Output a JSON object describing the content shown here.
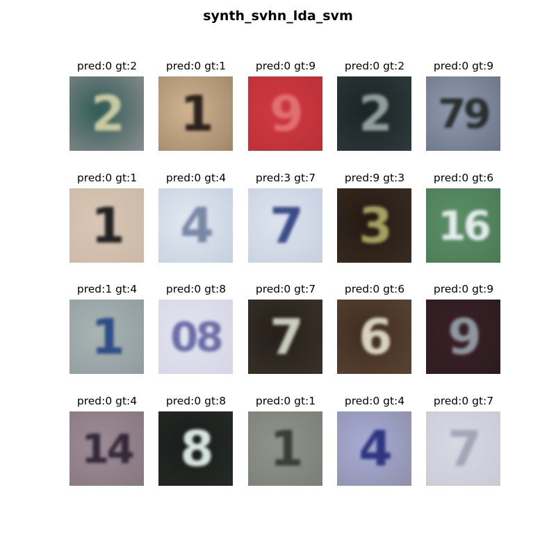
{
  "title": "synth_svhn_lda_svm",
  "samples": [
    {
      "label": "pred:0 gt:2",
      "digit_text": "2",
      "bg": "#2f5c55",
      "bg2": "#8b8c8e",
      "fg": "#c9c9a0"
    },
    {
      "label": "pred:0 gt:1",
      "digit_text": "1",
      "bg": "#cfb48f",
      "bg2": "#a0876a",
      "fg": "#2b221c"
    },
    {
      "label": "pred:0 gt:9",
      "digit_text": "9",
      "bg": "#d2383f",
      "bg2": "#b83038",
      "fg": "#e07070"
    },
    {
      "label": "pred:0 gt:2",
      "digit_text": "2",
      "bg": "#1b2325",
      "bg2": "#2e3a3b",
      "fg": "#8f9e9a"
    },
    {
      "label": "pred:0 gt:9",
      "digit_text": "79",
      "bg": "#8f9bb0",
      "bg2": "#6a7388",
      "fg": "#2a2f2c"
    },
    {
      "label": "pred:0 gt:1",
      "digit_text": "1",
      "bg": "#d9c6b4",
      "bg2": "#cbb8a6",
      "fg": "#222"
    },
    {
      "label": "pred:0 gt:4",
      "digit_text": "4",
      "bg": "#e3e8f0",
      "bg2": "#c4cfdf",
      "fg": "#7a88a5"
    },
    {
      "label": "pred:3 gt:7",
      "digit_text": "7",
      "bg": "#dde3ee",
      "bg2": "#c7cfe0",
      "fg": "#3b4c88"
    },
    {
      "label": "pred:9 gt:3",
      "digit_text": "3",
      "bg": "#231a14",
      "bg2": "#3a2c20",
      "fg": "#a4a060"
    },
    {
      "label": "pred:0 gt:6",
      "digit_text": "16",
      "bg": "#5b8f66",
      "bg2": "#4a7a55",
      "fg": "#e4ecee"
    },
    {
      "label": "pred:1 gt:4",
      "digit_text": "1",
      "bg": "#a9b4b4",
      "bg2": "#8f9c9d",
      "fg": "#2d4d84"
    },
    {
      "label": "pred:0 gt:8",
      "digit_text": "08",
      "bg": "#e4e3ef",
      "bg2": "#d6d5e6",
      "fg": "#6b6fa8"
    },
    {
      "label": "pred:0 gt:7",
      "digit_text": "7",
      "bg": "#261f1a",
      "bg2": "#3a3229",
      "fg": "#c9cdbd"
    },
    {
      "label": "pred:0 gt:6",
      "digit_text": "6",
      "bg": "#3f2c22",
      "bg2": "#5a4333",
      "fg": "#d8d2c2"
    },
    {
      "label": "pred:0 gt:9",
      "digit_text": "9",
      "bg": "#3a2025",
      "bg2": "#2a1c20",
      "fg": "#8e96a0"
    },
    {
      "label": "pred:0 gt:4",
      "digit_text": "14",
      "bg": "#9d8c95",
      "bg2": "#86767f",
      "fg": "#33283a"
    },
    {
      "label": "pred:0 gt:8",
      "digit_text": "8",
      "bg": "#191c1a",
      "bg2": "#262a27",
      "fg": "#d7e5e0"
    },
    {
      "label": "pred:0 gt:1",
      "digit_text": "1",
      "bg": "#8f948a",
      "bg2": "#7a7f76",
      "fg": "#3a3e39"
    },
    {
      "label": "pred:0 gt:4",
      "digit_text": "4",
      "bg": "#a7acd6",
      "bg2": "#8f8faa",
      "fg": "#2f3680"
    },
    {
      "label": "pred:0 gt:7",
      "digit_text": "7",
      "bg": "#d7d8e2",
      "bg2": "#c9cad6",
      "fg": "#a2a6b6"
    }
  ]
}
